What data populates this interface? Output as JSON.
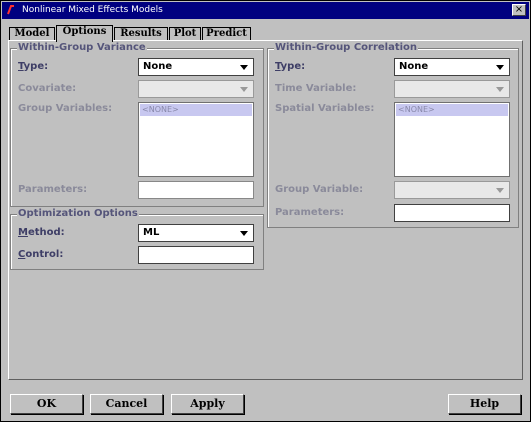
{
  "window": {
    "title": "Nonlinear Mixed Effects Models",
    "close_glyph": "×"
  },
  "tabs": [
    {
      "label": "Model"
    },
    {
      "label": "Options"
    },
    {
      "label": "Results"
    },
    {
      "label": "Plot"
    },
    {
      "label": "Predict"
    }
  ],
  "active_tab": "Options",
  "variance": {
    "title": "Within-Group Variance",
    "type_label": "Type:",
    "type_value": "None",
    "covariate_label": "Covariate:",
    "covariate_value": "",
    "group_vars_label": "Group Variables:",
    "group_vars_item": "<NONE>",
    "parameters_label": "Parameters:",
    "parameters_value": ""
  },
  "correlation": {
    "title": "Within-Group Correlation",
    "type_label": "Type:",
    "type_value": "None",
    "time_var_label": "Time Variable:",
    "time_var_value": "",
    "spatial_vars_label": "Spatial Variables:",
    "spatial_vars_item": "<NONE>",
    "group_var_label": "Group Variable:",
    "group_var_value": "",
    "parameters_label": "Parameters:",
    "parameters_value": ""
  },
  "optimization": {
    "title": "Optimization Options",
    "method_label": "Method:",
    "method_value": "ML",
    "control_label": "Control:",
    "control_value": ""
  },
  "buttons": {
    "ok": "OK",
    "cancel": "Cancel",
    "apply": "Apply",
    "help": "Help"
  },
  "colors": {
    "titlebar": "#000080",
    "background": "#c0c0c0",
    "label": "#3e3e66",
    "disabled_label": "#8a8a9a"
  }
}
